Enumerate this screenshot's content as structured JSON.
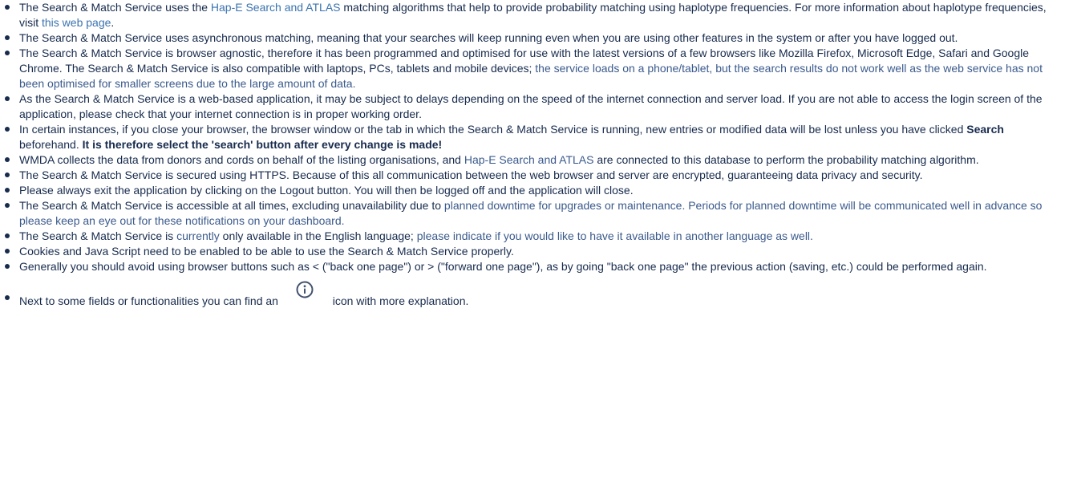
{
  "items": [
    {
      "parts": [
        {
          "t": "The Search & Match Service uses the "
        },
        {
          "t": "Hap-E Search and ATLAS",
          "cls": "link"
        },
        {
          "t": " matching algorithms that help to provide probability matching using haplotype frequencies. For more information about haplotype frequencies, visit "
        },
        {
          "t": "this web page",
          "cls": "link"
        },
        {
          "t": "."
        }
      ]
    },
    {
      "parts": [
        {
          "t": "The Search & Match Service uses asynchronous matching, meaning that your searches will keep running even when you are using other features in the system or after you have logged out."
        }
      ]
    },
    {
      "parts": [
        {
          "t": "The Search & Match Service is browser agnostic, therefore it has been programmed and optimised for use with the latest versions of a few browsers like Mozilla Firefox, Microsoft Edge, Safari and Google Chrome. The Search & Match Service is also compatible with laptops, PCs, tablets and mobile devices; "
        },
        {
          "t": "the service loads on a phone/tablet, but the search results do not work well as the web service has not been optimised for smaller screens due to the large amount of data.",
          "cls": "blue"
        }
      ]
    },
    {
      "parts": [
        {
          "t": "As the Search & Match Service is a web-based application, it may be subject to delays depending on the speed of the internet connection and server load. If you are not able to access the login screen of the application, please check that your internet connection is in proper working order."
        }
      ]
    },
    {
      "parts": [
        {
          "t": "In certain instances, if you close your browser, the browser window or the tab in which the Search & Match Service is running, new entries or modified data will be lost unless you have clicked "
        },
        {
          "t": "Search",
          "cls": "bold"
        },
        {
          "t": " beforehand. "
        },
        {
          "t": "It is therefore select the 'search' button after every change is made!",
          "cls": "bold"
        }
      ]
    },
    {
      "parts": [
        {
          "t": "WMDA collects the data from donors and cords on behalf of the listing organisations, and "
        },
        {
          "t": "Hap-E Search and ATLAS",
          "cls": "blue"
        },
        {
          "t": " are connected to this database to perform the probability matching algorithm."
        }
      ]
    },
    {
      "parts": [
        {
          "t": "The Search & Match Service is secured using HTTPS. Because of this all communication between the web browser and server are encrypted, guaranteeing data privacy and security."
        }
      ]
    },
    {
      "parts": [
        {
          "t": "Please always exit the application by clicking on the Logout button.  You will then be logged off and the application will close."
        }
      ]
    },
    {
      "parts": [
        {
          "t": "The Search & Match Service is accessible at all times, excluding unavailability due to "
        },
        {
          "t": "planned downtime for upgrades or maintenance. Periods for planned downtime will be communicated well in advance so please keep an eye out for these notifications on your dashboard.",
          "cls": "blue"
        }
      ]
    },
    {
      "parts": [
        {
          "t": "The Search & Match Service is "
        },
        {
          "t": "currently",
          "cls": "blue"
        },
        {
          "t": " only available in the English language; "
        },
        {
          "t": "please indicate if you would like to have it available in another language as well.",
          "cls": "blue"
        }
      ]
    },
    {
      "parts": [
        {
          "t": "Cookies and Java Script need to be enabled to be able to use the Search & Match Service properly."
        }
      ]
    },
    {
      "parts": [
        {
          "t": "Generally you should avoid using browser buttons such as < (\"back one page\") or > (\"forward one page\"), as by going \"back one page\" the previous action (saving, etc.) could be performed again."
        }
      ]
    }
  ],
  "last_item": {
    "before": "Next to some fields or functionalities you can find an ",
    "icon": "info-circle-icon",
    "after": " icon with more explanation."
  }
}
